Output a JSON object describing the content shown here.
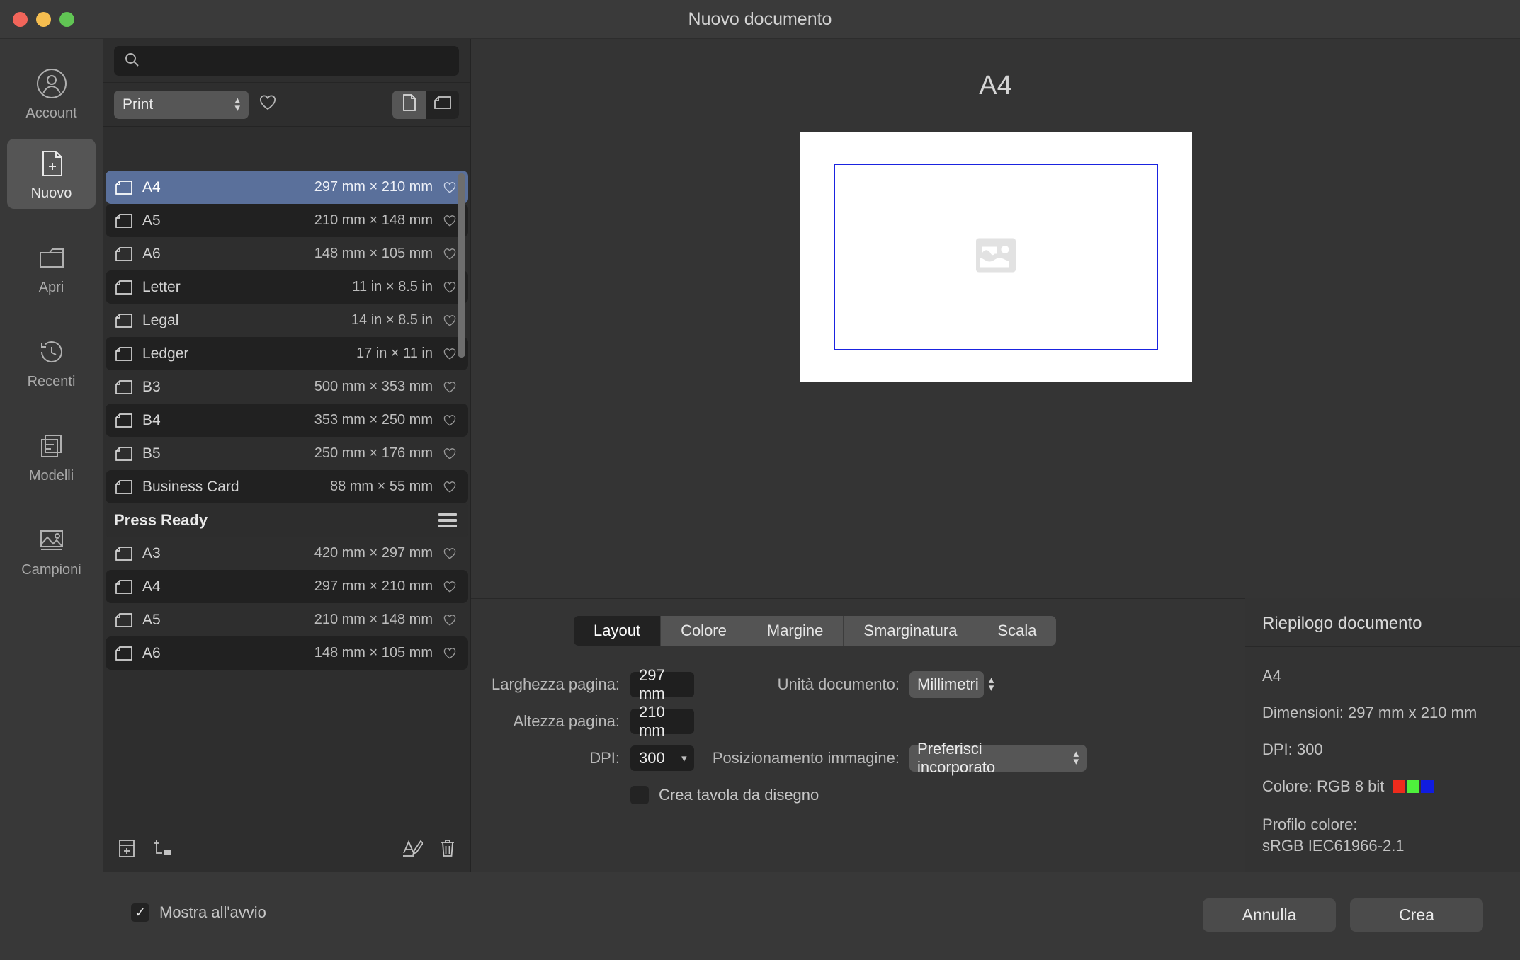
{
  "window": {
    "title": "Nuovo documento",
    "traffic_lights": [
      "close",
      "minimize",
      "maximize"
    ]
  },
  "rail": {
    "items": [
      {
        "label": "Account",
        "icon": "account-icon",
        "active": false
      },
      {
        "label": "Nuovo",
        "icon": "new-document-icon",
        "active": true
      },
      {
        "label": "Apri",
        "icon": "open-folder-icon",
        "active": false
      },
      {
        "label": "Recenti",
        "icon": "recent-clock-icon",
        "active": false
      },
      {
        "label": "Modelli",
        "icon": "templates-icon",
        "active": false
      },
      {
        "label": "Campioni",
        "icon": "samples-image-icon",
        "active": false
      }
    ]
  },
  "presets_panel": {
    "search": {
      "placeholder": "",
      "value": "",
      "icon": "search-icon"
    },
    "category": {
      "value": "Print"
    },
    "favorites_filter_icon": "heart-icon",
    "view_toggle": {
      "portrait_icon": "portrait-page-icon",
      "landscape_icon": "landscape-page-icon",
      "selected": "portrait"
    },
    "rows": [
      {
        "kind": "item",
        "name": "A4",
        "dimensions": "297 mm × 210 mm",
        "selected": true
      },
      {
        "kind": "item",
        "name": "A5",
        "dimensions": "210 mm × 148 mm",
        "selected": false
      },
      {
        "kind": "item",
        "name": "A6",
        "dimensions": "148 mm × 105 mm",
        "selected": false
      },
      {
        "kind": "item",
        "name": "Letter",
        "dimensions": "11 in × 8.5 in",
        "selected": false
      },
      {
        "kind": "item",
        "name": "Legal",
        "dimensions": "14 in × 8.5 in",
        "selected": false
      },
      {
        "kind": "item",
        "name": "Ledger",
        "dimensions": "17 in × 11 in",
        "selected": false
      },
      {
        "kind": "item",
        "name": "B3",
        "dimensions": "500 mm × 353 mm",
        "selected": false
      },
      {
        "kind": "item",
        "name": "B4",
        "dimensions": "353 mm × 250 mm",
        "selected": false
      },
      {
        "kind": "item",
        "name": "B5",
        "dimensions": "250 mm × 176 mm",
        "selected": false
      },
      {
        "kind": "item",
        "name": "Business Card",
        "dimensions": "88 mm × 55 mm",
        "selected": false
      },
      {
        "kind": "section",
        "name": "Press Ready"
      },
      {
        "kind": "item",
        "name": "A3",
        "dimensions": "420 mm × 297 mm",
        "selected": false
      },
      {
        "kind": "item",
        "name": "A4",
        "dimensions": "297 mm × 210 mm",
        "selected": false
      },
      {
        "kind": "item",
        "name": "A5",
        "dimensions": "210 mm × 148 mm",
        "selected": false
      },
      {
        "kind": "item",
        "name": "A6",
        "dimensions": "148 mm × 105 mm",
        "selected": false
      }
    ],
    "toolbar": {
      "add_preset_icon": "add-preset-icon",
      "add_category_icon": "add-category-icon",
      "rename_icon": "rename-icon",
      "delete_icon": "trash-icon"
    }
  },
  "preview": {
    "title": "A4",
    "placeholder_icon": "image-placeholder-icon",
    "margin_color": "#1a23e0"
  },
  "settings": {
    "tabs": [
      {
        "label": "Layout",
        "active": true
      },
      {
        "label": "Colore",
        "active": false
      },
      {
        "label": "Margine",
        "active": false
      },
      {
        "label": "Smarginatura",
        "active": false
      },
      {
        "label": "Scala",
        "active": false
      }
    ],
    "fields": {
      "page_width": {
        "label": "Larghezza pagina:",
        "value": "297 mm"
      },
      "page_height": {
        "label": "Altezza pagina:",
        "value": "210 mm"
      },
      "dpi": {
        "label": "DPI:",
        "value": "300"
      },
      "document_unit": {
        "label": "Unità documento:",
        "value": "Millimetri"
      },
      "image_placement": {
        "label": "Posizionamento immagine:",
        "value": "Preferisci incorporato"
      },
      "create_artboard": {
        "label": "Crea tavola da disegno",
        "checked": false
      }
    }
  },
  "summary": {
    "title": "Riepilogo documento",
    "preset": "A4",
    "dimensions": "Dimensioni: 297 mm x 210 mm",
    "dpi": "DPI:  300",
    "color": "Colore: RGB 8 bit",
    "swatches": [
      "#ee2b1c",
      "#4ef13c",
      "#101ce0"
    ],
    "profile_label": "Profilo colore:",
    "profile_value": "sRGB IEC61966-2.1"
  },
  "footer": {
    "show_on_startup": {
      "label": "Mostra all'avvio",
      "checked": true
    },
    "cancel_label": "Annulla",
    "create_label": "Crea"
  },
  "colors": {
    "selection_blue": "#5a709b",
    "window_bg": "#2b2b2b",
    "rail_bg": "#383838",
    "panel_bg": "#343434",
    "list_bg": "#2e2e2e"
  }
}
